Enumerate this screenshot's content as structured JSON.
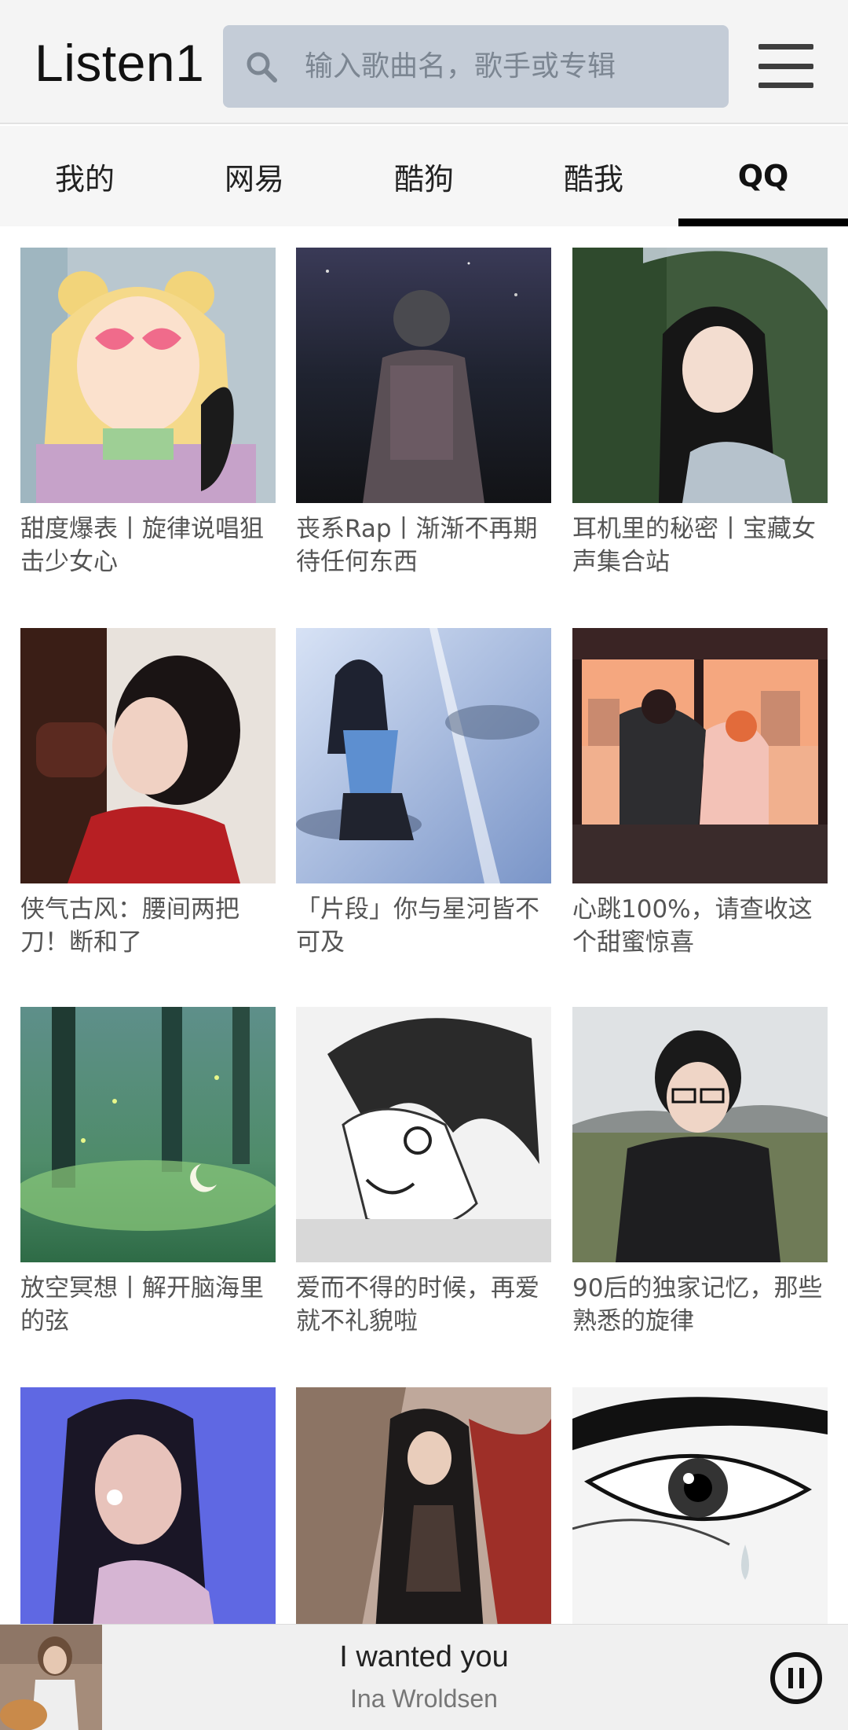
{
  "app": {
    "title": "Listen1"
  },
  "search": {
    "placeholder": "输入歌曲名，歌手或专辑",
    "icon": "search-icon"
  },
  "header": {
    "menu_icon": "hamburger-menu-icon"
  },
  "tabs": [
    {
      "label": "我的",
      "active": false
    },
    {
      "label": "网易",
      "active": false
    },
    {
      "label": "酷狗",
      "active": false
    },
    {
      "label": "酷我",
      "active": false
    },
    {
      "label": "QQ",
      "active": true
    }
  ],
  "playlists": [
    {
      "title": "甜度爆表丨旋律说唱狙击少女心"
    },
    {
      "title": "丧系Rap丨渐渐不再期待任何东西"
    },
    {
      "title": "耳机里的秘密丨宝藏女声集合站"
    },
    {
      "title": "侠气古风：腰间两把刀！断和了"
    },
    {
      "title": "「片段」你与星河皆不可及"
    },
    {
      "title": "心跳100%，请查收这个甜蜜惊喜"
    },
    {
      "title": "放空冥想丨解开脑海里的弦"
    },
    {
      "title": "爱而不得的时候，再爱就不礼貌啦"
    },
    {
      "title": "90后的独家记忆，那些熟悉的旋律"
    },
    {
      "title": ""
    },
    {
      "title": ""
    },
    {
      "title": ""
    }
  ],
  "player": {
    "title": "I wanted you",
    "artist": "Ina Wroldsen",
    "state_icon": "pause-icon"
  },
  "colors": {
    "header_bg": "#f4f4f4",
    "search_bg": "#c4ccd7",
    "active_tab_indicator": "#000000",
    "player_bg": "#f0f0f0"
  }
}
